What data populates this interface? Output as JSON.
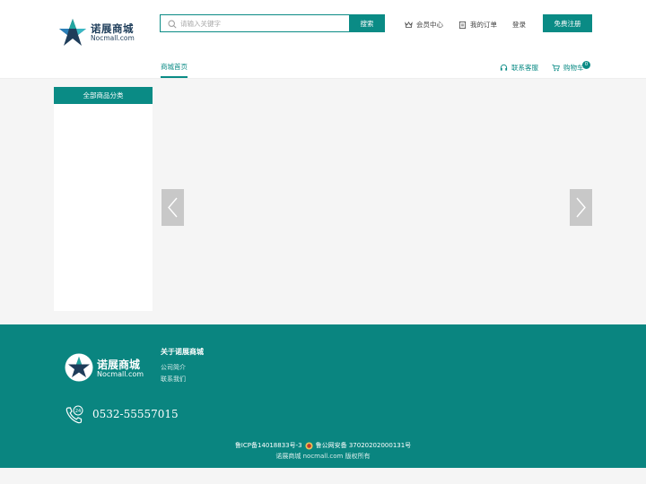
{
  "header": {
    "logo_cn": "诺展商城",
    "logo_en": "Nocmall.com",
    "search": {
      "placeholder": "请输入关键字",
      "value": "",
      "button_label": "搜索"
    },
    "links": {
      "member_center": "会员中心",
      "my_orders": "我的订单",
      "login": "登录"
    },
    "register_label": "免费注册"
  },
  "nav": {
    "home": "商城首页",
    "customer_service": "联系客服",
    "cart": "购物车",
    "cart_count": "0"
  },
  "category": {
    "title": "全部商品分类"
  },
  "footer": {
    "logo_cn": "诺展商城",
    "logo_en": "Nocmall.com",
    "about_title": "关于诺展商城",
    "about_links": [
      "公司简介",
      "联系我们"
    ],
    "phone": "0532-55557015",
    "icp": "鲁ICP备14018833号-3",
    "police": "鲁公网安备 37020202000131号",
    "copyright": "诺展商城 nocmall.com 版权所有"
  },
  "icons": [
    "search-icon",
    "crown-icon",
    "clipboard-icon",
    "headset-icon",
    "cart-icon",
    "chevron-left-icon",
    "chevron-right-icon",
    "phone-24h-icon",
    "police-badge-icon"
  ],
  "colors": {
    "brand": "#0a8b85",
    "footer_bg": "#0a8580",
    "page_bg": "#f5f5f5",
    "arrow_bg": "#c8c8c8"
  }
}
